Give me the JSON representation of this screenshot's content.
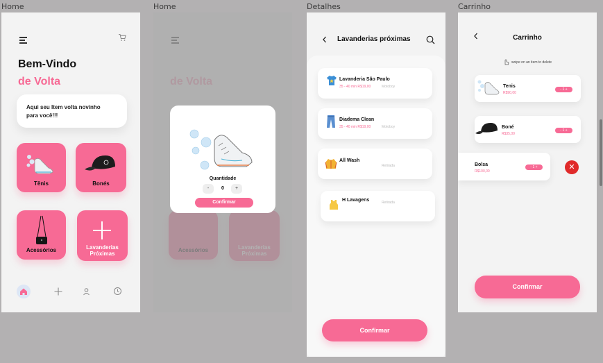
{
  "frames": [
    {
      "label": "Home"
    },
    {
      "label": "Home"
    },
    {
      "label": "Detalhes"
    },
    {
      "label": "Carrinho"
    }
  ],
  "home": {
    "title_line1": "Bem-Vindo",
    "title_line2": "de Volta",
    "welcome_text_line1": "Aqui seu Item volta novinho",
    "welcome_text_line2": "para você!!!",
    "categories": [
      {
        "label": "Tênis",
        "icon": "sneaker-icon"
      },
      {
        "label": "Bonés",
        "icon": "cap-icon"
      },
      {
        "label": "Acessórios",
        "icon": "bag-icon"
      },
      {
        "label_line1": "Lavanderias",
        "label_line2": "Próximas",
        "icon": "plus-icon"
      }
    ],
    "nav": [
      "home-icon",
      "plus-icon",
      "user-icon",
      "history-icon"
    ]
  },
  "modal": {
    "quantity_label": "Quantidade",
    "minus": "-",
    "value": "0",
    "plus": "+",
    "confirm_label": "Confirmar"
  },
  "details": {
    "header_title": "Lavanderias próximas",
    "shops": [
      {
        "name": "Lavanderia São Paulo",
        "info": "35 - 40 min R$19,00",
        "extra": "Motoboy"
      },
      {
        "name": "Diadema Clean",
        "info": "35 - 40 min R$19,00",
        "extra": "Motoboy"
      },
      {
        "name": "All Wash",
        "info": "",
        "extra": "Retirada"
      },
      {
        "name": "H Lavagens",
        "info": "",
        "extra": "Retirada"
      }
    ],
    "confirm_label": "Confirmar"
  },
  "cart": {
    "header_title": "Carrinho",
    "hint": "swipe on an item to delete",
    "items": [
      {
        "name": "Tenis",
        "price": "R$90,00"
      },
      {
        "name": "Boné",
        "price": "R$35,00"
      },
      {
        "name": "Bolsa",
        "price": "R$100,00"
      }
    ],
    "stepper_text": "- 1 +",
    "confirm_label": "Confirmar"
  },
  "colors": {
    "accent": "#f76a95",
    "delete": "#e02a2a",
    "background": "#f3f3f3"
  }
}
